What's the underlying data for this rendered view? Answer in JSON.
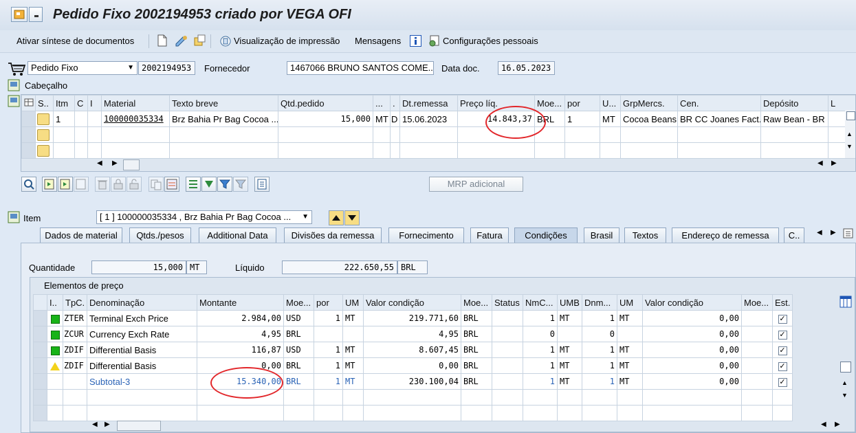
{
  "window": {
    "title": "Pedido Fixo 2002194953 criado por VEGA OFI"
  },
  "toolbar": {
    "sintese": "Ativar síntese de documentos",
    "visualizacao": "Visualização de impressão",
    "mensagens": "Mensagens",
    "config": "Configurações pessoais"
  },
  "header": {
    "doc_type": "Pedido Fixo",
    "doc_number": "2002194953",
    "fornecedor_label": "Fornecedor",
    "fornecedor_value": "1467066 BRUNO SANTOS COME...",
    "data_doc_label": "Data doc.",
    "data_doc_value": "16.05.2023",
    "cabecalho": "Cabeçalho"
  },
  "items_table": {
    "headers": [
      "S..",
      "Itm",
      "C",
      "I",
      "Material",
      "Texto breve",
      "Qtd.pedido",
      "...",
      ".",
      "Dt.remessa",
      "Preço líq.",
      "Moe...",
      "por",
      "U...",
      "GrpMercs.",
      "Cen.",
      "Depósito",
      "L"
    ],
    "rows": [
      {
        "itm": "1",
        "material": "100000035334",
        "texto": "Brz  Bahia Pr Bag Cocoa ...",
        "qtd": "15,000",
        "un": "MT",
        "c2": "D",
        "dt": "15.06.2023",
        "preco": "14.843,37",
        "moeda": "BRL",
        "por": "1",
        "u": "MT",
        "grp": "Cocoa Beans",
        "cen": "BR CC Joanes Fact...",
        "dep": "Raw Bean - BR"
      }
    ]
  },
  "buttons": {
    "mrp": "MRP adicional"
  },
  "item_select": {
    "label": "Item",
    "value": "[ 1 ] 100000035334 , Brz  Bahia Pr Bag Cocoa ..."
  },
  "tabs": [
    "Dados de material",
    "Qtds./pesos",
    "Additional Data",
    "Divisões da remessa",
    "Fornecimento",
    "Fatura",
    "Condições",
    "Brasil",
    "Textos",
    "Endereço de remessa",
    "C.."
  ],
  "active_tab": "Condições",
  "conditions": {
    "quantidade_label": "Quantidade",
    "quantidade_value": "15,000",
    "quantidade_unit": "MT",
    "liquido_label": "Líquido",
    "liquido_value": "222.650,55",
    "liquido_currency": "BRL",
    "section_title": "Elementos de preço",
    "headers": [
      "I..",
      "TpC.",
      "Denominação",
      "Montante",
      "Moe...",
      "por",
      "UM",
      "Valor condição",
      "Moe...",
      "Status",
      "NmC...",
      "UMB",
      "Dnm...",
      "UM",
      "Valor condição",
      "Moe...",
      "Est."
    ],
    "rows": [
      {
        "status": "green",
        "tpc": "ZTER",
        "den": "Terminal Exch Price",
        "mont": "2.984,00",
        "moe": "USD",
        "por": "1",
        "um": "MT",
        "valor": "219.771,60",
        "moe2": "BRL",
        "nmc": "1",
        "umb": "MT",
        "dnm": "1",
        "um2": "MT",
        "valor2": "0,00",
        "checked": true
      },
      {
        "status": "green",
        "tpc": "ZCUR",
        "den": "Currency Exch Rate",
        "mont": "4,95",
        "moe": "BRL",
        "por": "",
        "um": "",
        "valor": "4,95",
        "moe2": "BRL",
        "nmc": "0",
        "umb": "",
        "dnm": "0",
        "um2": "",
        "valor2": "0,00",
        "checked": true
      },
      {
        "status": "green",
        "tpc": "ZDIF",
        "den": "Differential Basis",
        "mont": "116,87",
        "moe": "USD",
        "por": "1",
        "um": "MT",
        "valor": "8.607,45",
        "moe2": "BRL",
        "nmc": "1",
        "umb": "MT",
        "dnm": "1",
        "um2": "MT",
        "valor2": "0,00",
        "checked": true
      },
      {
        "status": "warning",
        "tpc": "ZDIF",
        "den": "Differential Basis",
        "mont": "0,00",
        "moe": "BRL",
        "por": "1",
        "um": "MT",
        "valor": "0,00",
        "moe2": "BRL",
        "nmc": "1",
        "umb": "MT",
        "dnm": "1",
        "um2": "MT",
        "valor2": "0,00",
        "checked": true
      },
      {
        "status": "none",
        "tpc": "",
        "den": "Subtotal-3",
        "mont": "15.340,00",
        "moe": "BRL",
        "por": "1",
        "um": "MT",
        "valor": "230.100,04",
        "moe2": "BRL",
        "nmc": "1",
        "umb": "MT",
        "dnm": "1",
        "um2": "MT",
        "valor2": "0,00",
        "checked": true,
        "subtotal": true
      }
    ]
  }
}
